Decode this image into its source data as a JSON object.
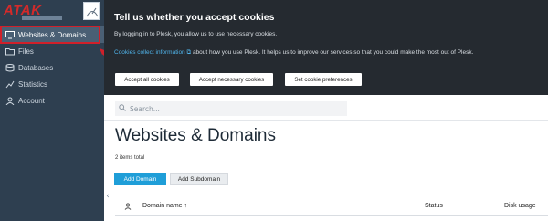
{
  "logo": {
    "text": "ATAK"
  },
  "sidebar": {
    "items": [
      {
        "label": "Websites & Domains",
        "icon": "monitor-icon"
      },
      {
        "label": "Files",
        "icon": "folder-icon"
      },
      {
        "label": "Databases",
        "icon": "database-icon"
      },
      {
        "label": "Statistics",
        "icon": "chart-icon"
      },
      {
        "label": "Account",
        "icon": "user-icon"
      }
    ]
  },
  "cookie": {
    "title": "Tell us whether you accept cookies",
    "line1": "By logging in to Plesk, you allow us to use necessary cookies.",
    "link": "Cookies collect information",
    "line2_rest": " about how you use Plesk. It helps us to improve our services so that you could make the most out of Plesk.",
    "buttons": {
      "accept_all": "Accept all cookies",
      "accept_necessary": "Accept necessary cookies",
      "preferences": "Set cookie preferences"
    }
  },
  "search": {
    "placeholder": "Search..."
  },
  "main": {
    "title": "Websites & Domains",
    "items_total": "2 items total",
    "add_domain": "Add Domain",
    "add_subdomain": "Add Subdomain"
  },
  "table": {
    "columns": {
      "name": "Domain name ↑",
      "status": "Status",
      "disk": "Disk usage"
    }
  },
  "colors": {
    "sidebar_bg": "#2e3f50",
    "banner_bg": "#252a30",
    "accent": "#1f9ed8",
    "highlight": "#d0202a"
  }
}
